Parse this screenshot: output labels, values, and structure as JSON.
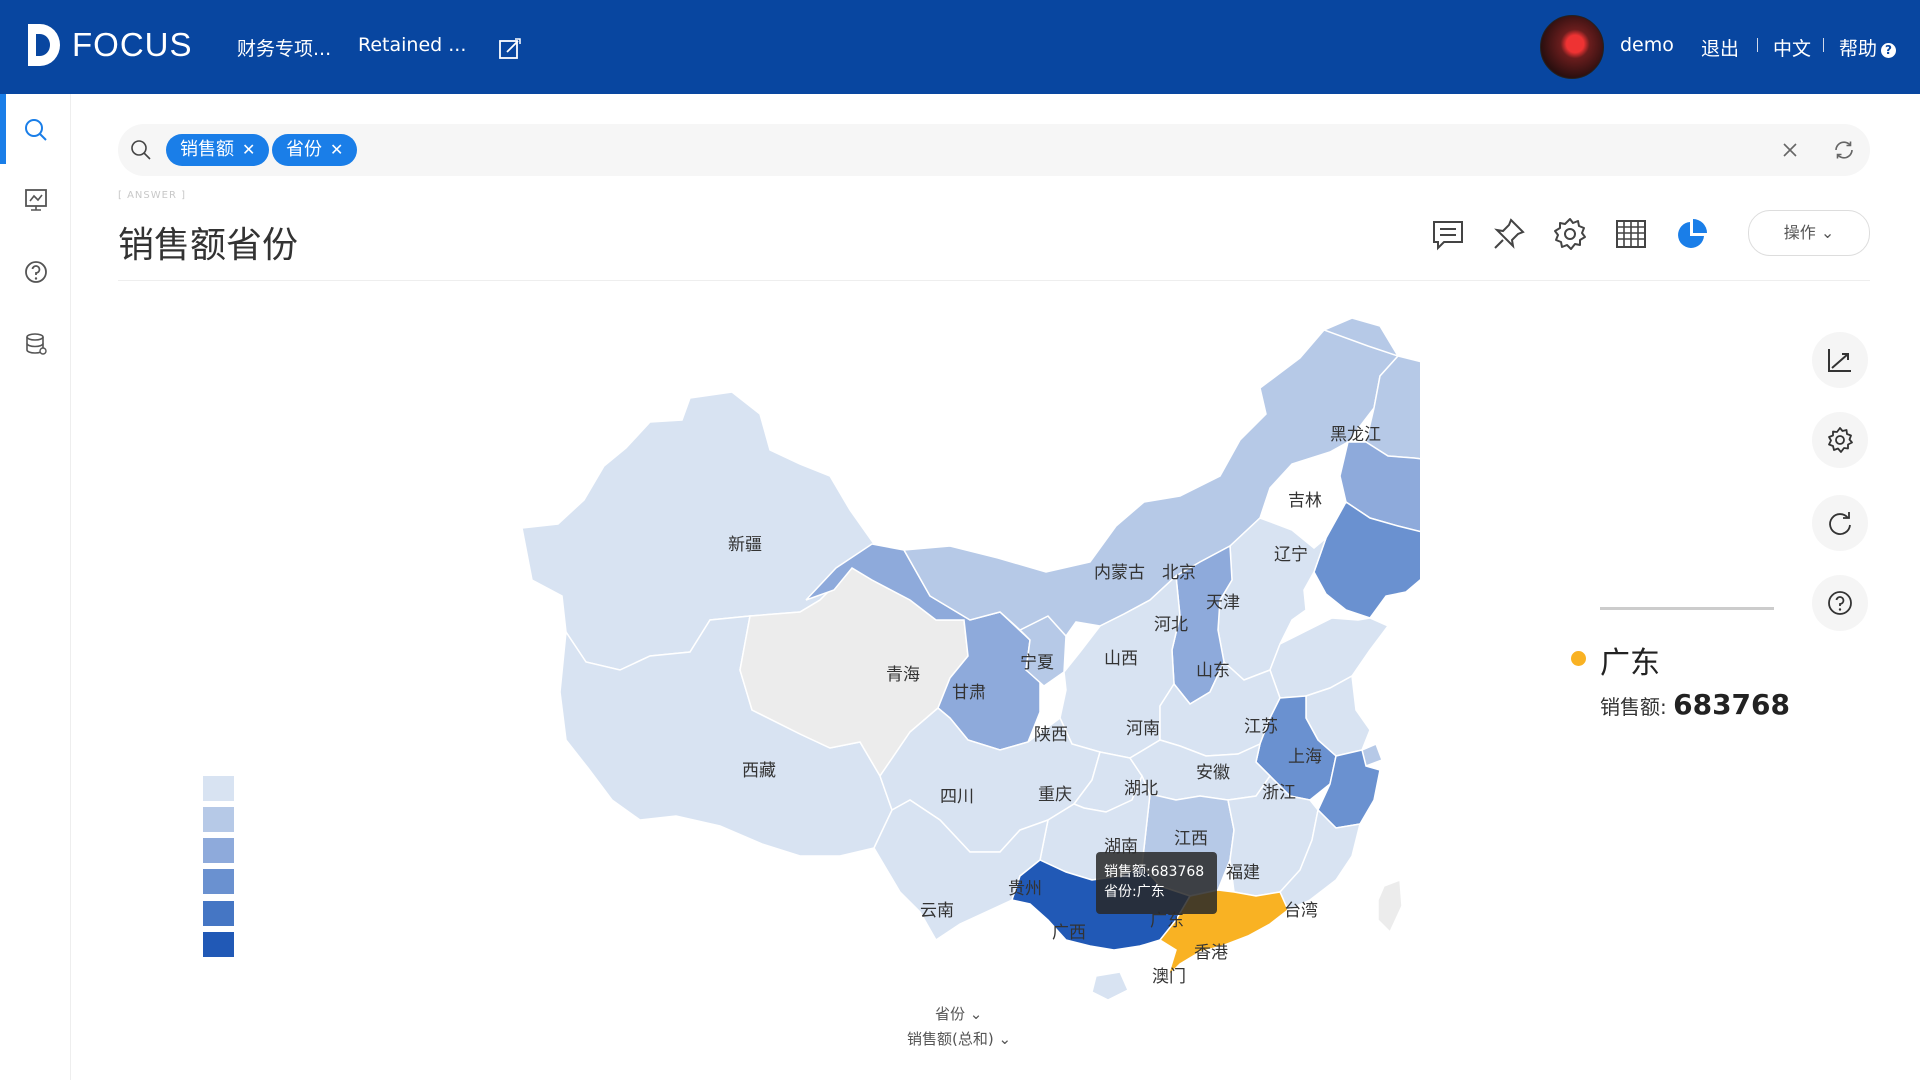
{
  "header": {
    "logo_text": "FOCUS",
    "tabs": [
      "财务专项...",
      "Retained ..."
    ],
    "username": "demo",
    "logout": "退出",
    "language": "中文",
    "help": "帮助"
  },
  "search": {
    "chips": [
      "销售额",
      "省份"
    ]
  },
  "answer": {
    "tag": "[ ANSWER ]",
    "title": "销售额省份",
    "ops_label": "操作"
  },
  "chart_data": {
    "type": "map",
    "measure": "销售额",
    "dimension": "省份",
    "legend_colors": [
      "#d8e3f2",
      "#b6c9e7",
      "#8eaadb",
      "#6a91d0",
      "#4576c4",
      "#2159b6"
    ],
    "highlight_color": "#f9b223",
    "provinces": [
      "新疆",
      "西藏",
      "青海",
      "甘肃",
      "宁夏",
      "内蒙古",
      "黑龙江",
      "吉林",
      "辽宁",
      "北京",
      "天津",
      "河北",
      "山西",
      "山东",
      "陕西",
      "河南",
      "江苏",
      "上海",
      "安徽",
      "浙江",
      "四川",
      "重庆",
      "湖北",
      "湖南",
      "江西",
      "福建",
      "贵州",
      "云南",
      "广西",
      "广东",
      "香港",
      "澳门",
      "台湾"
    ],
    "selected": {
      "province": "广东",
      "value": 683768
    }
  },
  "tooltip": {
    "line1": "销售额:683768",
    "line2": "省份:广东"
  },
  "detail": {
    "name": "广东",
    "measure_label": "销售额:",
    "value": "683768"
  },
  "axes": {
    "dimension_label": "省份",
    "measure_label": "销售额(总和)"
  }
}
